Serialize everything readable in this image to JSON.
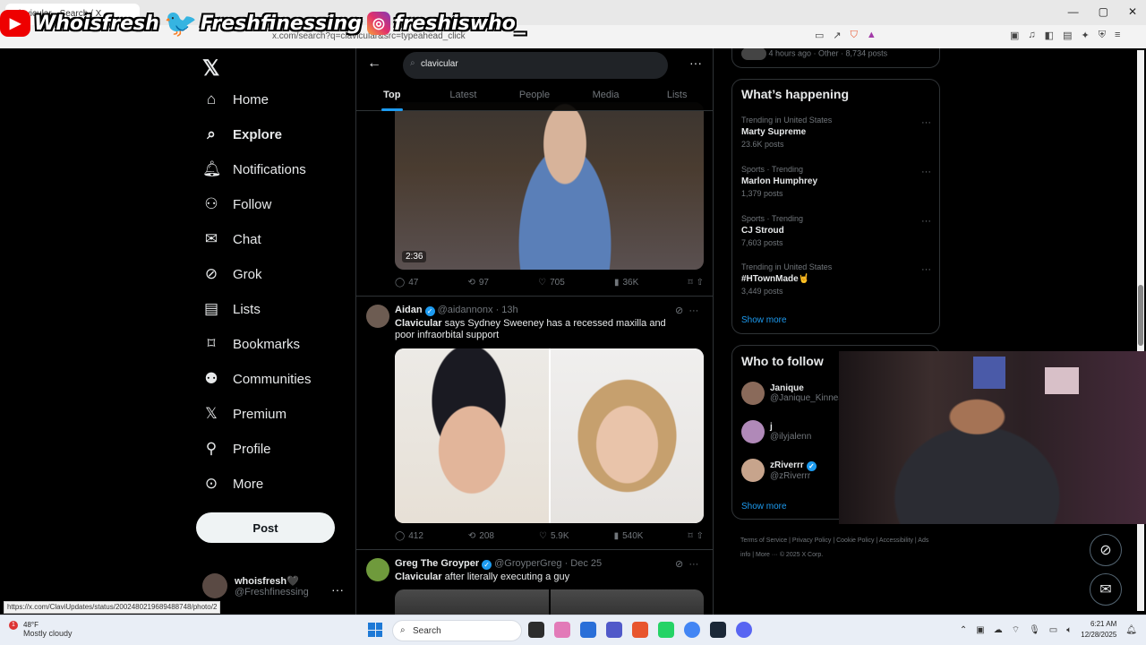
{
  "browser": {
    "tab_title": "clavicular - Search / X",
    "url": "x.com/search?q=clavicular&src=typeahead_click",
    "window_controls": [
      "—",
      "▢",
      "✕"
    ]
  },
  "overlay": {
    "youtube": "Whoisfresh",
    "twitter": "Freshfinessing",
    "instagram": "freshiswho_"
  },
  "nav": {
    "items": [
      {
        "label": "Home",
        "icon": "home-icon"
      },
      {
        "label": "Explore",
        "icon": "search-icon"
      },
      {
        "label": "Notifications",
        "icon": "bell-icon"
      },
      {
        "label": "Follow",
        "icon": "person-add-icon"
      },
      {
        "label": "Chat",
        "icon": "mail-icon"
      },
      {
        "label": "Grok",
        "icon": "grok-icon"
      },
      {
        "label": "Lists",
        "icon": "list-icon"
      },
      {
        "label": "Bookmarks",
        "icon": "bookmark-icon"
      },
      {
        "label": "Communities",
        "icon": "people-icon"
      },
      {
        "label": "Premium",
        "icon": "x-icon"
      },
      {
        "label": "Profile",
        "icon": "person-icon"
      },
      {
        "label": "More",
        "icon": "more-circle-icon"
      }
    ],
    "post_label": "Post",
    "account_name": "whoisfresh🖤",
    "account_handle": "@Freshfinessing"
  },
  "search": {
    "query": "clavicular",
    "tabs": [
      "Top",
      "Latest",
      "People",
      "Media",
      "Lists"
    ]
  },
  "video": {
    "duration": "2:36"
  },
  "tweet1_actions": {
    "replies": "47",
    "reposts": "97",
    "likes": "705",
    "views": "36K"
  },
  "tweet2": {
    "name": "Aidan",
    "handle": "@aidannonx",
    "time": "· 13h",
    "keyword": "Clavicular",
    "text": "says Sydney Sweeney has a recessed maxilla and poor infraorbital support",
    "replies": "412",
    "reposts": "208",
    "likes": "5.9K",
    "views": "540K"
  },
  "tweet3": {
    "name": "Greg The Groyper",
    "handle": "@GroyperGreg",
    "time": "· Dec 25",
    "keyword": "Clavicular",
    "text": "after literally executing a guy"
  },
  "right": {
    "top_meta": "4 hours ago · Other · 8,734 posts",
    "happening_title": "What’s happening",
    "trends": [
      {
        "meta": "Trending in United States",
        "title": "Marty Supreme",
        "count": "23.6K posts"
      },
      {
        "meta": "Sports · Trending",
        "title": "Marlon Humphrey",
        "count": "1,379 posts"
      },
      {
        "meta": "Sports · Trending",
        "title": "CJ Stroud",
        "count": "7,603 posts"
      },
      {
        "meta": "Trending in United States",
        "title": "#HTownMade🤘",
        "count": "3,449 posts"
      }
    ],
    "show_more": "Show more",
    "wtf_title": "Who to follow",
    "follow": [
      {
        "name": "Janique",
        "handle": "@Janique_Kinnea"
      },
      {
        "name": "j",
        "handle": "@ilyjalenn"
      },
      {
        "name": "zRiverrr",
        "handle": "@zRiverrr"
      }
    ],
    "footer": "Terms of Service  |  Privacy Policy  |  Cookie Policy  |  Accessibility  |  Ads info  |  More ···  © 2025 X Corp."
  },
  "status_url": "https://x.com/ClaviUpdates/status/2002480219689488748/photo/2",
  "taskbar": {
    "temp": "48°F",
    "weather": "Mostly cloudy",
    "notif_count": "1",
    "search": "Search",
    "time": "6:21 AM",
    "date": "12/28/2025"
  },
  "colors": {
    "accent": "#1d9bf0",
    "bg": "#000000",
    "border": "#2f3336",
    "muted": "#71767b"
  }
}
